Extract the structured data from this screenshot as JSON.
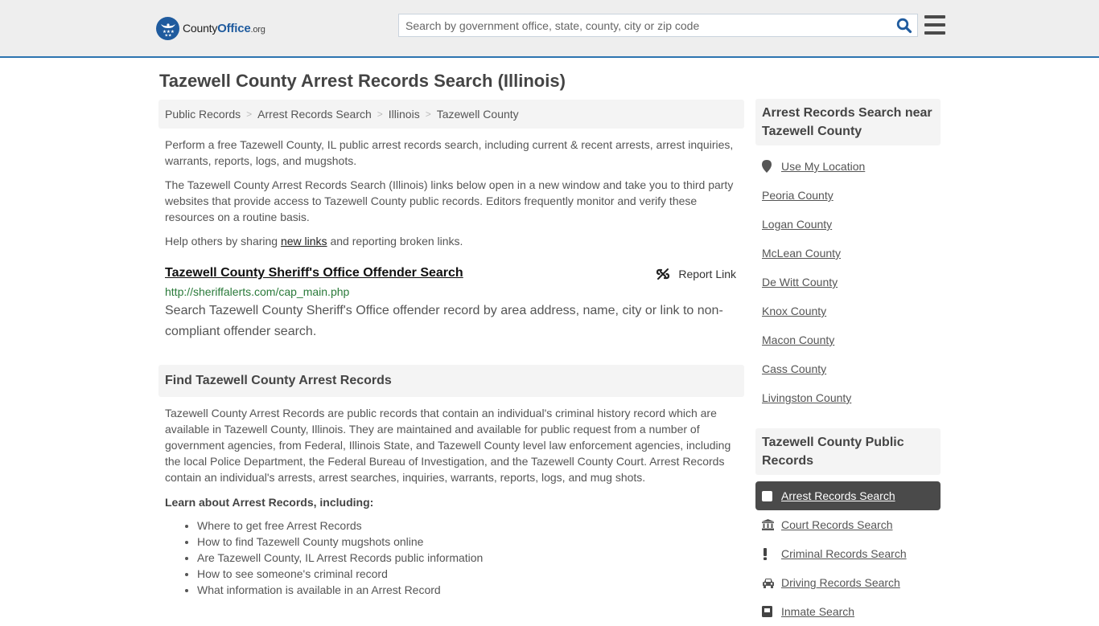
{
  "header": {
    "logo": {
      "prefix": "County",
      "brand": "Office",
      "tld": ".org"
    },
    "search": {
      "placeholder": "Search by government office, state, county, city or zip code",
      "value": ""
    },
    "icons": {
      "search": "search-icon",
      "menu": "hamburger-menu-icon"
    }
  },
  "page": {
    "title": "Tazewell County Arrest Records Search (Illinois)"
  },
  "breadcrumb": [
    {
      "label": "Public Records"
    },
    {
      "label": "Arrest Records Search"
    },
    {
      "label": "Illinois"
    },
    {
      "label": "Tazewell County"
    }
  ],
  "intro": {
    "p1": "Perform a free Tazewell County, IL public arrest records search, including current & recent arrests, arrest inquiries, warrants, reports, logs, and mugshots.",
    "p2": "The Tazewell County Arrest Records Search (Illinois) links below open in a new window and take you to third party websites that provide access to Tazewell County public records. Editors frequently monitor and verify these resources on a routine basis.",
    "p3_before": "Help others by sharing ",
    "p3_link": "new links",
    "p3_after": " and reporting broken links."
  },
  "listing": {
    "title": "Tazewell County Sheriff's Office Offender Search",
    "report_label": "Report Link",
    "url": "http://sheriffalerts.com/cap_main.php",
    "description": "Search Tazewell County Sheriff's Office offender record by area address, name, city or link to non-compliant offender search."
  },
  "find_section": {
    "heading": "Find Tazewell County Arrest Records",
    "body": "Tazewell County Arrest Records are public records that contain an individual's criminal history record which are available in Tazewell County, Illinois. They are maintained and available for public request from a number of government agencies, from Federal, Illinois State, and Tazewell County level law enforcement agencies, including the local Police Department, the Federal Bureau of Investigation, and the Tazewell County Court. Arrest Records contain an individual's arrests, arrest searches, inquiries, warrants, reports, logs, and mug shots.",
    "learn_heading": "Learn about Arrest Records, including:",
    "learn_items": [
      "Where to get free Arrest Records",
      "How to find Tazewell County mugshots online",
      "Are Tazewell County, IL Arrest Records public information",
      "How to see someone's criminal record",
      "What information is available in an Arrest Record"
    ]
  },
  "sidebar": {
    "nearby_heading": "Arrest Records Search near Tazewell County",
    "use_location": "Use My Location",
    "nearby": [
      "Peoria County",
      "Logan County",
      "McLean County",
      "De Witt County",
      "Knox County",
      "Macon County",
      "Cass County",
      "Livingston County"
    ],
    "records_heading": "Tazewell County Public Records",
    "records": [
      {
        "label": "Arrest Records Search",
        "icon": "square-icon",
        "active": true
      },
      {
        "label": "Court Records Search",
        "icon": "courthouse-icon",
        "active": false
      },
      {
        "label": "Criminal Records Search",
        "icon": "exclamation-icon",
        "active": false
      },
      {
        "label": "Driving Records Search",
        "icon": "car-icon",
        "active": false
      },
      {
        "label": "Inmate Search",
        "icon": "inmate-icon",
        "active": false
      }
    ]
  },
  "colors": {
    "accent": "#2d74b0",
    "brand": "#1f5b9e",
    "url_green": "#2a7a3a",
    "active_bg": "#4a4a4a"
  }
}
